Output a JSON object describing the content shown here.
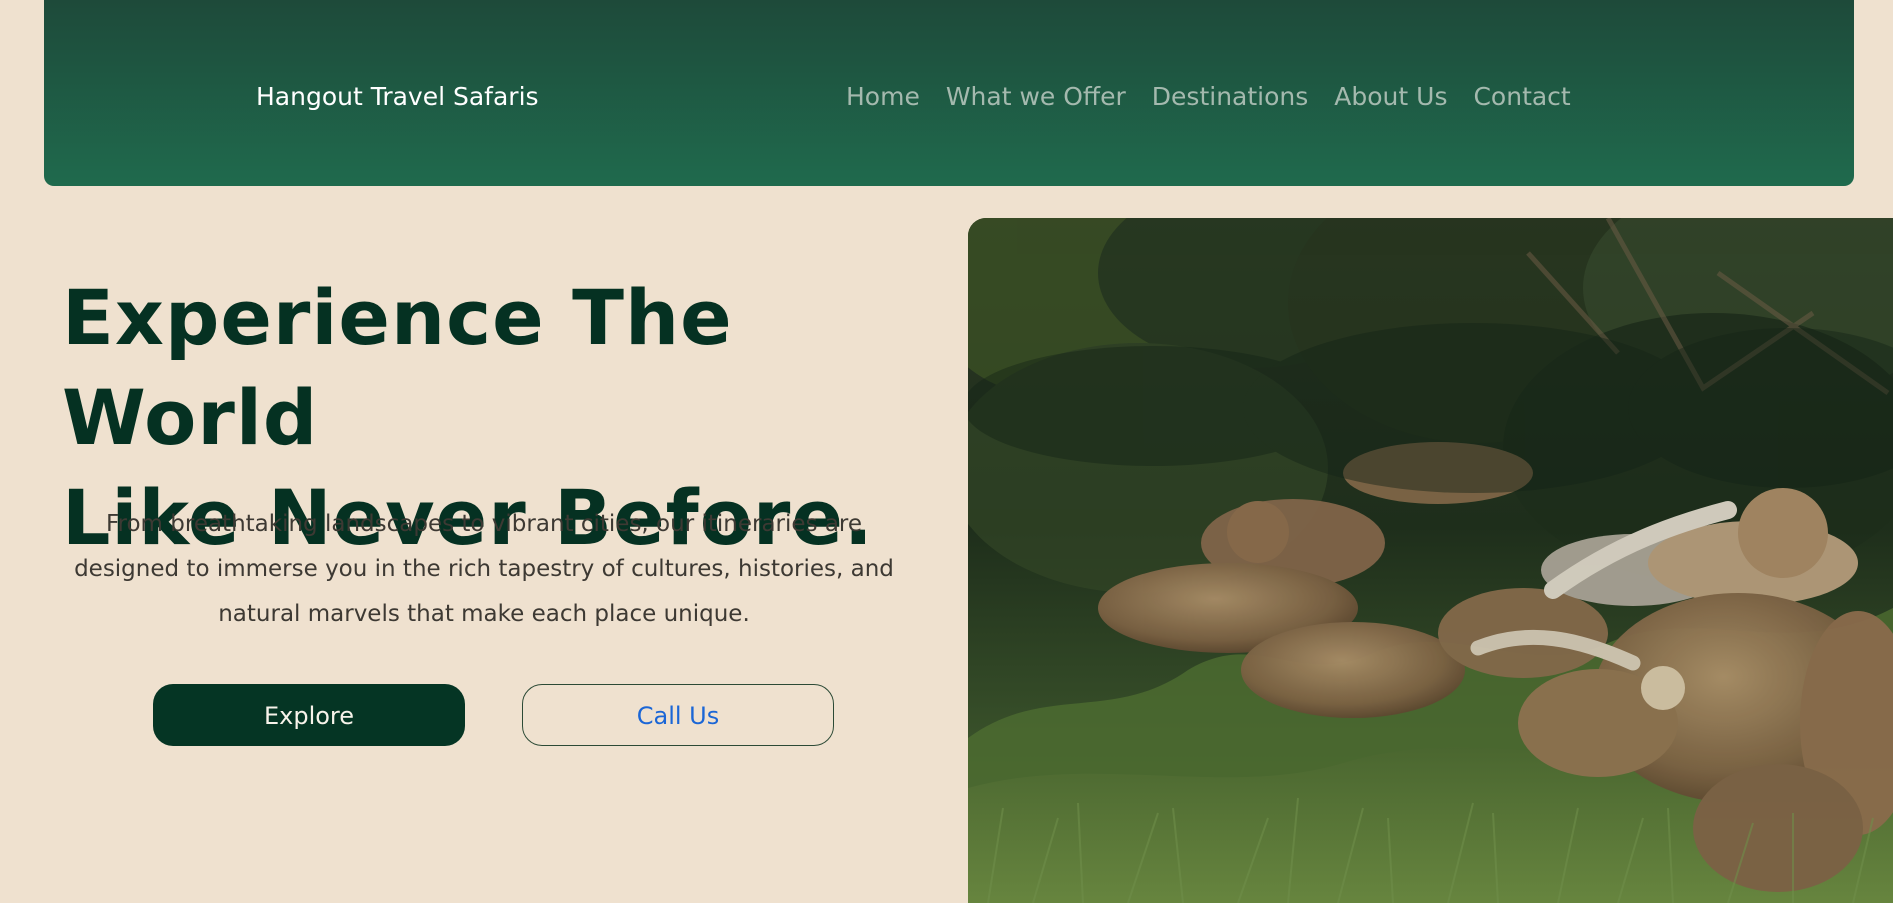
{
  "brand": {
    "name": "Hangout Travel Safaris"
  },
  "nav": {
    "links": [
      "Home",
      "What we Offer",
      "Destinations",
      "About Us",
      "Contact"
    ]
  },
  "hero": {
    "title_line1": "Experience The World",
    "title_line2": "Like Never Before.",
    "description": "From breathtaking landscapes to vibrant cities, our itineraries are designed to immerse you in the rich tapestry of cultures, histories, and natural marvels that make each place unique.",
    "explore_label": "Explore",
    "call_label": "Call Us"
  },
  "colors": {
    "nav_background": "#1f6a4d",
    "page_background": "#efe1cf",
    "title": "#053122",
    "primary_button": "#053524",
    "call_text": "#1b66d6"
  }
}
